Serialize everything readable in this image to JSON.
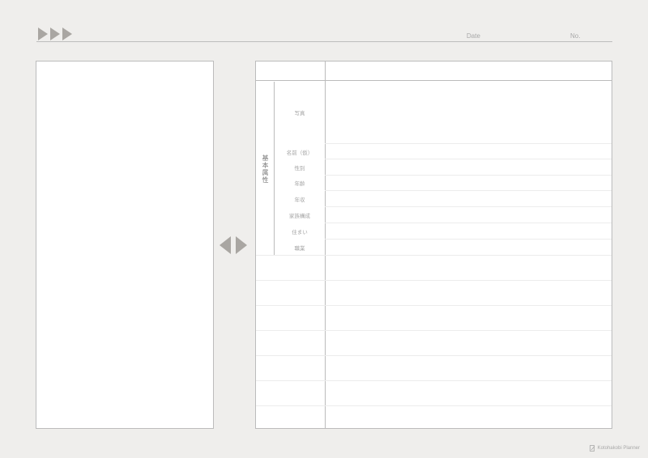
{
  "header": {
    "date_label": "Date",
    "no_label": "No."
  },
  "table": {
    "category": "基本属性",
    "rows": [
      {
        "label": "写真"
      },
      {
        "label": "名前（仮）"
      },
      {
        "label": "性別"
      },
      {
        "label": "年齢"
      },
      {
        "label": "年収"
      },
      {
        "label": "家族構成"
      },
      {
        "label": "住まい"
      },
      {
        "label": "職業"
      }
    ]
  },
  "footer": {
    "brand": "Kotohakobi Planner"
  },
  "colors": {
    "background": "#efeeec",
    "arrow": "#a9a6a2",
    "border": "#bcbcbc"
  }
}
